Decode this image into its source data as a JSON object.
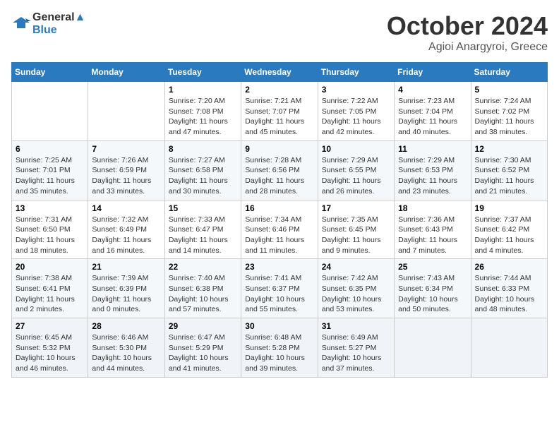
{
  "header": {
    "logo_line1": "General",
    "logo_line2": "Blue",
    "month": "October 2024",
    "location": "Agioi Anargyroi, Greece"
  },
  "weekdays": [
    "Sunday",
    "Monday",
    "Tuesday",
    "Wednesday",
    "Thursday",
    "Friday",
    "Saturday"
  ],
  "weeks": [
    [
      {
        "day": "",
        "info": ""
      },
      {
        "day": "",
        "info": ""
      },
      {
        "day": "1",
        "info": "Sunrise: 7:20 AM\nSunset: 7:08 PM\nDaylight: 11 hours and 47 minutes."
      },
      {
        "day": "2",
        "info": "Sunrise: 7:21 AM\nSunset: 7:07 PM\nDaylight: 11 hours and 45 minutes."
      },
      {
        "day": "3",
        "info": "Sunrise: 7:22 AM\nSunset: 7:05 PM\nDaylight: 11 hours and 42 minutes."
      },
      {
        "day": "4",
        "info": "Sunrise: 7:23 AM\nSunset: 7:04 PM\nDaylight: 11 hours and 40 minutes."
      },
      {
        "day": "5",
        "info": "Sunrise: 7:24 AM\nSunset: 7:02 PM\nDaylight: 11 hours and 38 minutes."
      }
    ],
    [
      {
        "day": "6",
        "info": "Sunrise: 7:25 AM\nSunset: 7:01 PM\nDaylight: 11 hours and 35 minutes."
      },
      {
        "day": "7",
        "info": "Sunrise: 7:26 AM\nSunset: 6:59 PM\nDaylight: 11 hours and 33 minutes."
      },
      {
        "day": "8",
        "info": "Sunrise: 7:27 AM\nSunset: 6:58 PM\nDaylight: 11 hours and 30 minutes."
      },
      {
        "day": "9",
        "info": "Sunrise: 7:28 AM\nSunset: 6:56 PM\nDaylight: 11 hours and 28 minutes."
      },
      {
        "day": "10",
        "info": "Sunrise: 7:29 AM\nSunset: 6:55 PM\nDaylight: 11 hours and 26 minutes."
      },
      {
        "day": "11",
        "info": "Sunrise: 7:29 AM\nSunset: 6:53 PM\nDaylight: 11 hours and 23 minutes."
      },
      {
        "day": "12",
        "info": "Sunrise: 7:30 AM\nSunset: 6:52 PM\nDaylight: 11 hours and 21 minutes."
      }
    ],
    [
      {
        "day": "13",
        "info": "Sunrise: 7:31 AM\nSunset: 6:50 PM\nDaylight: 11 hours and 18 minutes."
      },
      {
        "day": "14",
        "info": "Sunrise: 7:32 AM\nSunset: 6:49 PM\nDaylight: 11 hours and 16 minutes."
      },
      {
        "day": "15",
        "info": "Sunrise: 7:33 AM\nSunset: 6:47 PM\nDaylight: 11 hours and 14 minutes."
      },
      {
        "day": "16",
        "info": "Sunrise: 7:34 AM\nSunset: 6:46 PM\nDaylight: 11 hours and 11 minutes."
      },
      {
        "day": "17",
        "info": "Sunrise: 7:35 AM\nSunset: 6:45 PM\nDaylight: 11 hours and 9 minutes."
      },
      {
        "day": "18",
        "info": "Sunrise: 7:36 AM\nSunset: 6:43 PM\nDaylight: 11 hours and 7 minutes."
      },
      {
        "day": "19",
        "info": "Sunrise: 7:37 AM\nSunset: 6:42 PM\nDaylight: 11 hours and 4 minutes."
      }
    ],
    [
      {
        "day": "20",
        "info": "Sunrise: 7:38 AM\nSunset: 6:41 PM\nDaylight: 11 hours and 2 minutes."
      },
      {
        "day": "21",
        "info": "Sunrise: 7:39 AM\nSunset: 6:39 PM\nDaylight: 11 hours and 0 minutes."
      },
      {
        "day": "22",
        "info": "Sunrise: 7:40 AM\nSunset: 6:38 PM\nDaylight: 10 hours and 57 minutes."
      },
      {
        "day": "23",
        "info": "Sunrise: 7:41 AM\nSunset: 6:37 PM\nDaylight: 10 hours and 55 minutes."
      },
      {
        "day": "24",
        "info": "Sunrise: 7:42 AM\nSunset: 6:35 PM\nDaylight: 10 hours and 53 minutes."
      },
      {
        "day": "25",
        "info": "Sunrise: 7:43 AM\nSunset: 6:34 PM\nDaylight: 10 hours and 50 minutes."
      },
      {
        "day": "26",
        "info": "Sunrise: 7:44 AM\nSunset: 6:33 PM\nDaylight: 10 hours and 48 minutes."
      }
    ],
    [
      {
        "day": "27",
        "info": "Sunrise: 6:45 AM\nSunset: 5:32 PM\nDaylight: 10 hours and 46 minutes."
      },
      {
        "day": "28",
        "info": "Sunrise: 6:46 AM\nSunset: 5:30 PM\nDaylight: 10 hours and 44 minutes."
      },
      {
        "day": "29",
        "info": "Sunrise: 6:47 AM\nSunset: 5:29 PM\nDaylight: 10 hours and 41 minutes."
      },
      {
        "day": "30",
        "info": "Sunrise: 6:48 AM\nSunset: 5:28 PM\nDaylight: 10 hours and 39 minutes."
      },
      {
        "day": "31",
        "info": "Sunrise: 6:49 AM\nSunset: 5:27 PM\nDaylight: 10 hours and 37 minutes."
      },
      {
        "day": "",
        "info": ""
      },
      {
        "day": "",
        "info": ""
      }
    ]
  ]
}
